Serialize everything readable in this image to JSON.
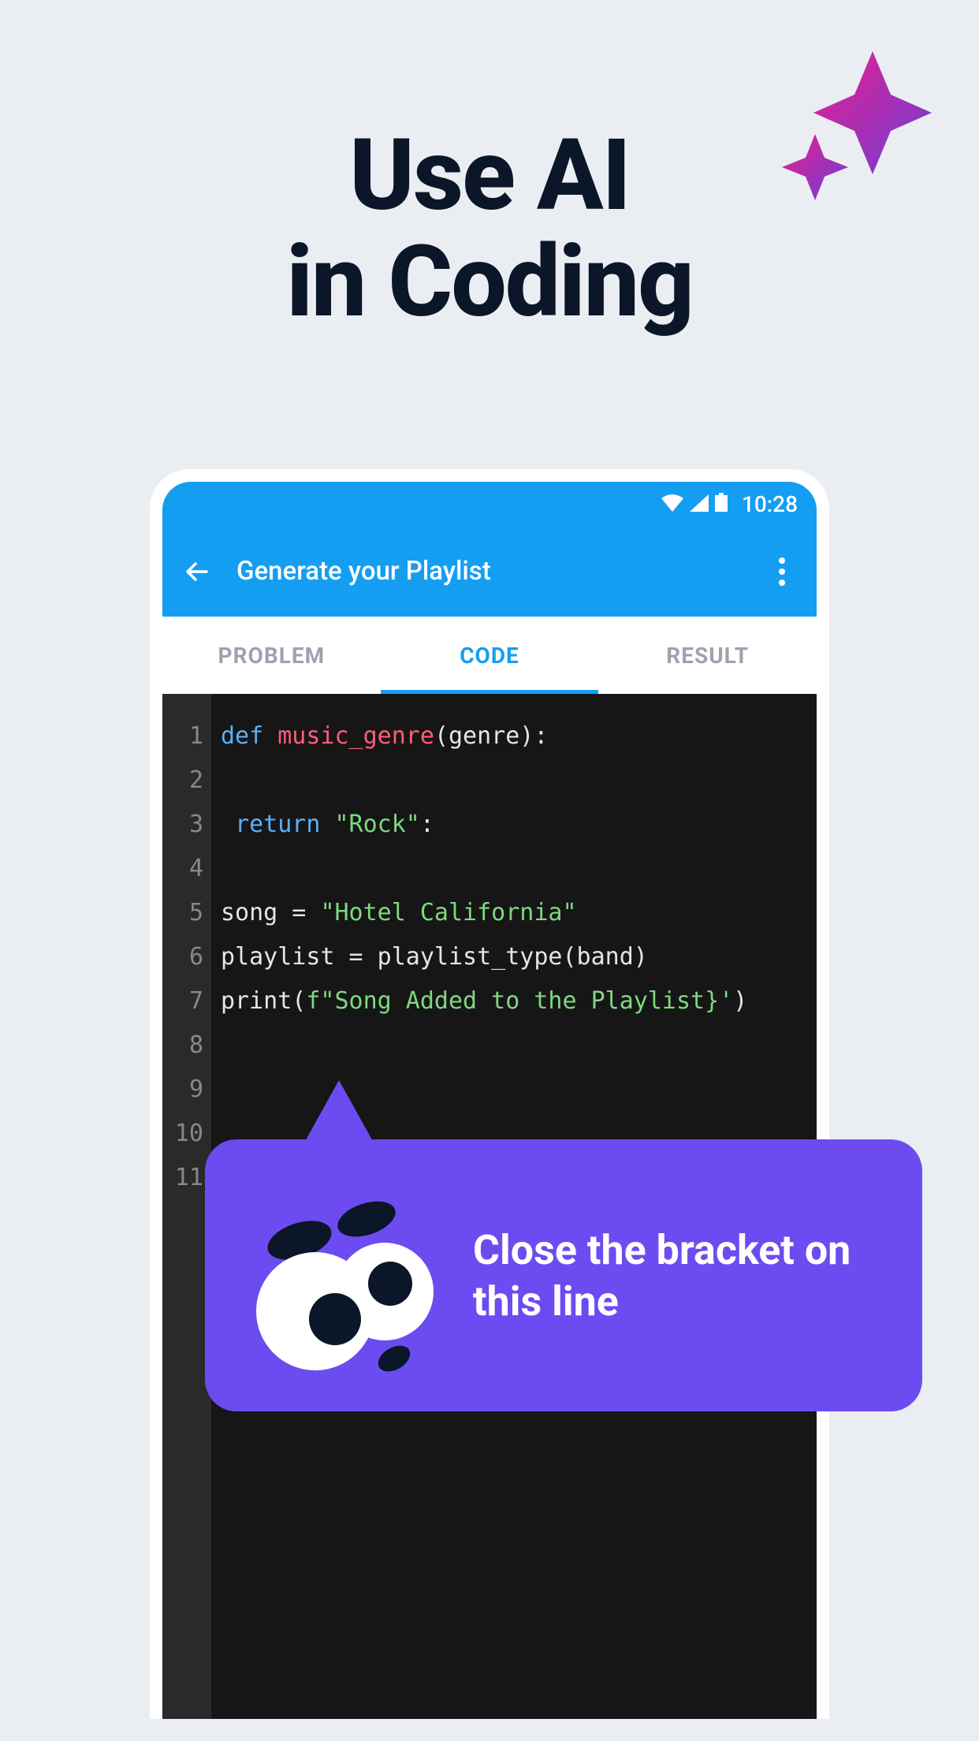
{
  "headline_line1": "Use AI",
  "headline_line2": "in Coding",
  "status": {
    "time": "10:28"
  },
  "appbar": {
    "title": "Generate your Playlist"
  },
  "tabs": {
    "problem": "PROBLEM",
    "code": "CODE",
    "result": "RESULT"
  },
  "editor": {
    "line_numbers": [
      "1",
      "2",
      "3",
      "4",
      "5",
      "6",
      "7",
      "8",
      "9",
      "10",
      "11"
    ],
    "line1": {
      "def": "def",
      "fn": "music_genre",
      "rest": "(genre):"
    },
    "line3": {
      "ret": "return",
      "str": "\"Rock\"",
      "colon": ":"
    },
    "line5": {
      "pre": "song = ",
      "str": "\"Hotel California\""
    },
    "line6": "playlist = playlist_type(band)",
    "line7": {
      "pre": "print(",
      "str": "f\"Song Added to the Playlist}'",
      "post": ")"
    }
  },
  "tooltip": {
    "text": "Close the bracket on this line"
  }
}
